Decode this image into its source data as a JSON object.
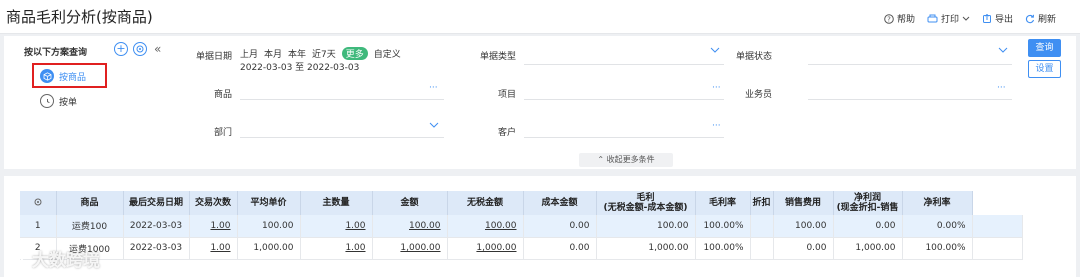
{
  "title": "商品毛利分析(按商品)",
  "toolbar": {
    "help": "帮助",
    "print": "打印",
    "export": "导出",
    "refresh": "刷新"
  },
  "scheme": {
    "title": "按以下方案查询",
    "items": [
      {
        "label": "按商品",
        "icon": "cube-icon",
        "selected": true
      },
      {
        "label": "按单",
        "icon": "clock-icon",
        "selected": false
      }
    ]
  },
  "filters": {
    "bill_date": {
      "label": "单据日期",
      "options": [
        "上月",
        "本月",
        "本年",
        "近7天",
        "更多",
        "自定义"
      ],
      "active": "更多",
      "range": "2022-03-03 至 2022-03-03"
    },
    "bill_type": {
      "label": "单据类型"
    },
    "bill_status": {
      "label": "单据状态"
    },
    "product": {
      "label": "商品"
    },
    "project": {
      "label": "项目"
    },
    "salesperson": {
      "label": "业务员"
    },
    "department": {
      "label": "部门"
    },
    "customer": {
      "label": "客户"
    },
    "ellipsis": "···",
    "query_button": "查询",
    "settings_button": "设置",
    "collapse_more": "收起更多条件"
  },
  "table": {
    "headers": [
      "商品",
      "最后交易日期",
      "交易次数",
      "平均单价",
      "主数量",
      "金额",
      "无税金额",
      "成本金额",
      "毛利",
      "(无税金额-成本金额)",
      "毛利率",
      "折扣",
      "销售费用",
      "净利润",
      "(现金折扣-销售",
      "净利率"
    ],
    "rows": [
      {
        "idx": "1",
        "product": "运费100",
        "date": "2022-03-03",
        "count": "1.00",
        "avg_price": "100.00",
        "qty": "1.00",
        "amount": "100.00",
        "untaxed": "100.00",
        "cost": "0.00",
        "gross": "100.00",
        "gross_rate": "100.00%",
        "discount": "",
        "sales_fee": "100.00",
        "net_profit": "0.00",
        "net_rate": "0.00%"
      },
      {
        "idx": "2",
        "product": "运费1000",
        "date": "2022-03-03",
        "count": "1.00",
        "avg_price": "1,000.00",
        "qty": "1.00",
        "amount": "1,000.00",
        "untaxed": "1,000.00",
        "cost": "0.00",
        "gross": "1,000.00",
        "gross_rate": "100.00%",
        "discount": "",
        "sales_fee": "0.00",
        "net_profit": "1,000.00",
        "net_rate": "100.00%"
      }
    ]
  },
  "watermark": "大数跨境",
  "colors": {
    "accent": "#3f8ff2",
    "active_tag": "#3fb97c",
    "highlight_border": "#e02020",
    "header_bg": "#dde9f8"
  }
}
